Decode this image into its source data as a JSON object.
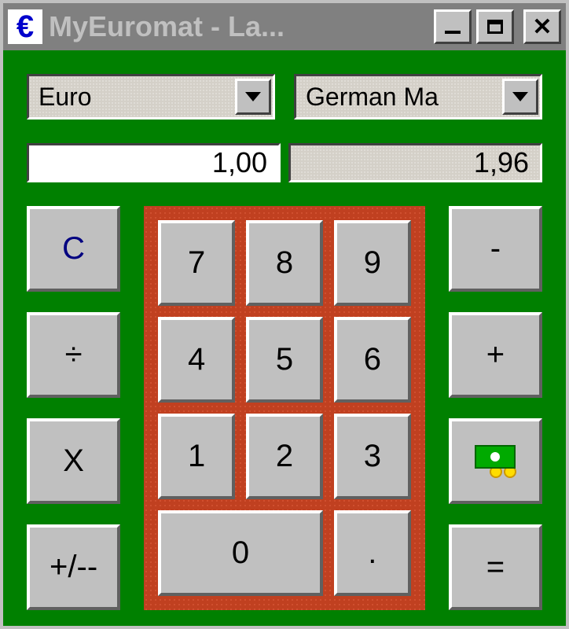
{
  "window": {
    "title": "MyEuromat - La..."
  },
  "dropdowns": {
    "source": {
      "selected": "Euro"
    },
    "target": {
      "selected": "German Ma"
    }
  },
  "displays": {
    "input": "1,00",
    "output": "1,96"
  },
  "buttons": {
    "clear": "C",
    "divide": "÷",
    "multiply": "X",
    "sign": "+/--",
    "minus": "-",
    "plus": "+",
    "equals": "=",
    "digit7": "7",
    "digit8": "8",
    "digit9": "9",
    "digit4": "4",
    "digit5": "5",
    "digit6": "6",
    "digit1": "1",
    "digit2": "2",
    "digit3": "3",
    "digit0": "0",
    "decimal": "."
  }
}
